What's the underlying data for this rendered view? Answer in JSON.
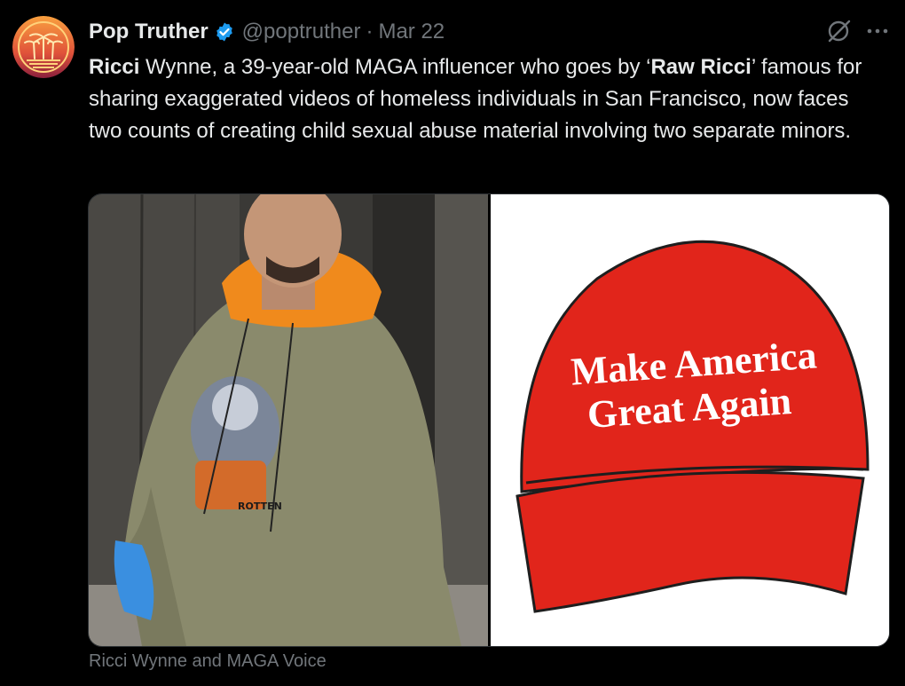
{
  "author": {
    "display_name": "Pop Truther",
    "handle": "@poptruther",
    "separator": "·",
    "date": "Mar 22",
    "verified": true,
    "avatar_icon": "palm-trees-sunset-logo"
  },
  "tweet": {
    "segments": [
      {
        "text": "Ricci",
        "bold": true
      },
      {
        "text": " Wynne, a 39-year-old MAGA influencer who goes by ‘",
        "bold": false
      },
      {
        "text": "Raw Ricci",
        "bold": true
      },
      {
        "text": "’ famous for sharing exaggerated videos of homeless individuals in San Francisco, now faces two counts of creating child sexual abuse material involving two separate minors.",
        "bold": false
      }
    ]
  },
  "media": {
    "hat_text_line1": "Make America",
    "hat_text_line2": "Great Again",
    "sweatshirt_patch_text": "ROTTEN",
    "caption": "Ricci Wynne and MAGA Voice"
  },
  "icons": {
    "verified": "verified-badge-icon",
    "grok": "grok-icon",
    "more": "more-icon"
  },
  "colors": {
    "background": "#000000",
    "text_primary": "#e7e9ea",
    "text_secondary": "#71767b",
    "verified_blue": "#1d9bf0",
    "hat_red": "#e1251b"
  }
}
